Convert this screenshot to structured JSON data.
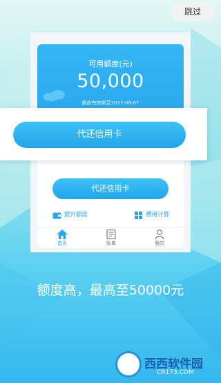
{
  "header": {
    "skip_label": "跳过"
  },
  "card": {
    "limit_label": "可用额度(元)",
    "limit_amount": "50,000",
    "expiry_text": "额度有效期至2017-06-07"
  },
  "popup": {
    "button_label": "代还信用卡"
  },
  "main": {
    "repay_button_label": "代还信用卡",
    "features": [
      {
        "label": "提升额度",
        "icon": "wallet-icon"
      },
      {
        "label": "费用计算",
        "icon": "grid-icon"
      }
    ]
  },
  "tabbar": {
    "items": [
      {
        "label": "首页",
        "icon": "home-icon",
        "active": true
      },
      {
        "label": "账单",
        "icon": "bill-icon",
        "active": false
      },
      {
        "label": "我的",
        "icon": "user-icon",
        "active": false
      }
    ]
  },
  "slogan": "额度高，最高至50000元",
  "watermark": {
    "name": "西西软件园",
    "url": "CR173.COM"
  },
  "colors": {
    "accent": "#2aa7e8",
    "card_blue": "#2aa8ee",
    "background_top": "#e4f7f4",
    "background_bottom": "#33b8ef"
  }
}
